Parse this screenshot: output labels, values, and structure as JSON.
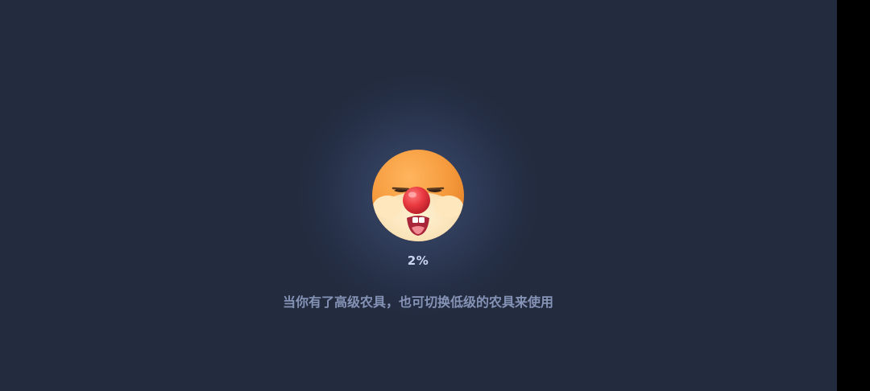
{
  "loading": {
    "progress_text": "2%",
    "progress_value": 2,
    "tip_text": "当你有了高级农具，也可切换低级的农具来使用"
  },
  "mascot": {
    "icon": "mascot-face-icon"
  },
  "colors": {
    "background": "#232b3f",
    "glow": "#3c4e73",
    "progress_text": "#c9d6f2",
    "tip_text": "#8593b6",
    "mascot_orange": "#f59a3c",
    "mascot_nose": "#e8383f"
  }
}
